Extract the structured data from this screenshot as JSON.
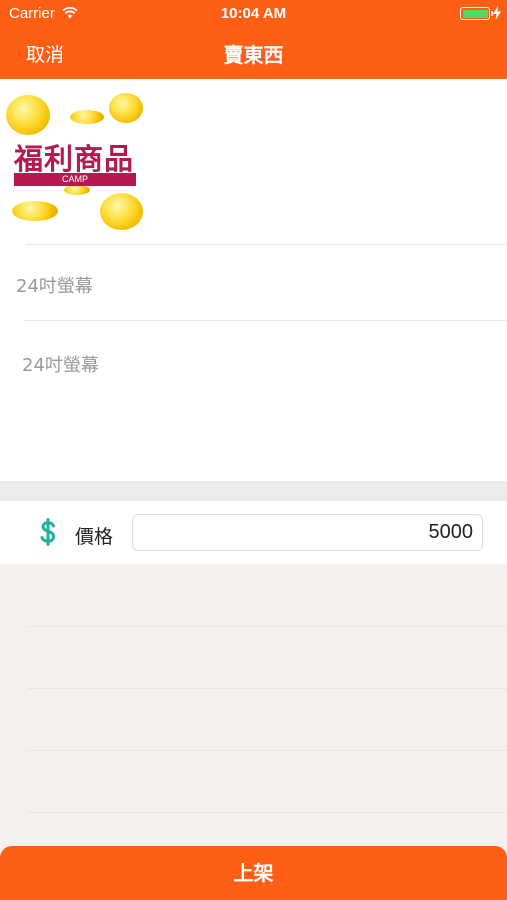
{
  "status_bar": {
    "carrier": "Carrier",
    "time": "10:04 AM",
    "battery_color": "#4cd964"
  },
  "nav": {
    "cancel_label": "取消",
    "title": "賣東西",
    "background_color": "#ff5e15"
  },
  "item": {
    "photo_logo_text": "福利商品",
    "photo_band_text": "CAMP",
    "title_value": "24吋螢幕",
    "description_value": "24吋螢幕"
  },
  "price": {
    "icon": "dollar-icon",
    "label": "價格",
    "value": "5000",
    "icon_color": "#20b29a"
  },
  "submit": {
    "label": "上架"
  }
}
